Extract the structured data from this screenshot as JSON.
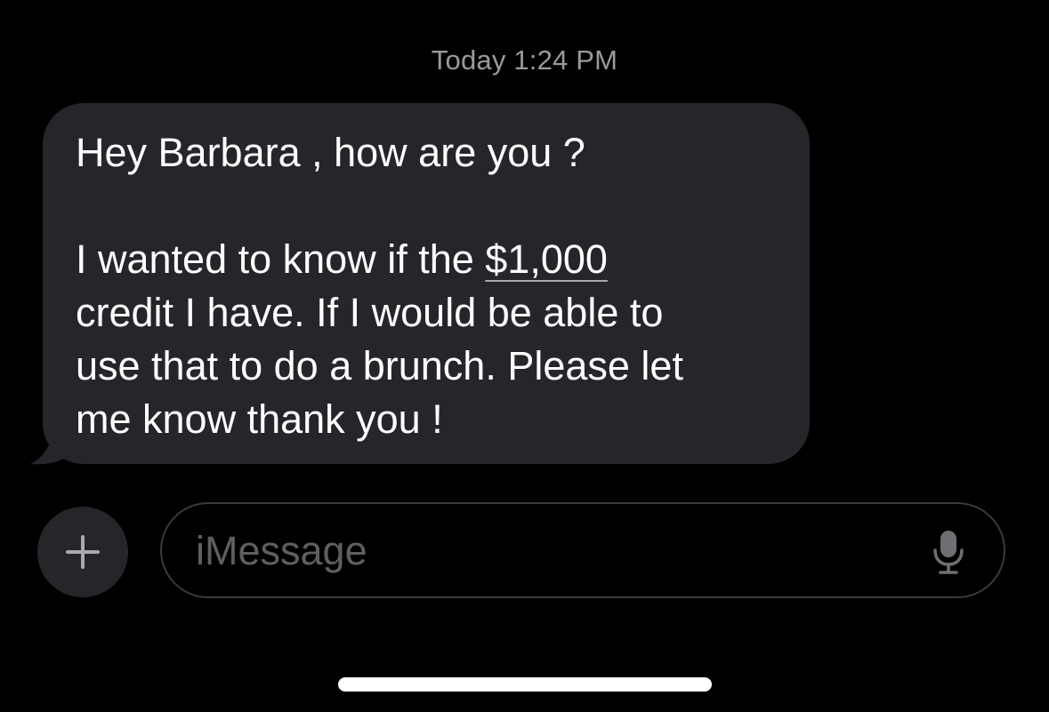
{
  "conversation": {
    "timestamp": "Today 1:24 PM",
    "message": {
      "line1": "Hey Barbara , how are you ?",
      "line2_prefix": "I wanted to know if the ",
      "line2_amount": "$1,000",
      "line3": "credit I have. If I would be able to",
      "line4": "use that to do a brunch. Please let",
      "line5": "me know thank you !"
    }
  },
  "composer": {
    "add_icon": "plus-icon",
    "placeholder": "iMessage",
    "mic_icon": "microphone-icon"
  },
  "colors": {
    "background": "#000000",
    "bubble": "#26252a",
    "timestamp": "#9a9a9e",
    "placeholder": "#5f5f63"
  }
}
